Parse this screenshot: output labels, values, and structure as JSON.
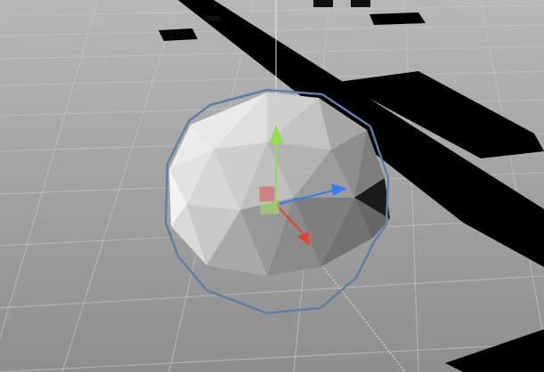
{
  "scene_view": {
    "floor_color": "#a7a7a7",
    "floor_color_near": "#8f8f8f",
    "grid_line_color": "#bdbdbd",
    "shadow_color": "#000000",
    "selection_outline_color": "#5f7fa8"
  },
  "selected_object": {
    "kind": "icosphere",
    "face_light": "#e3e3e3",
    "face_mid": "#b6b6b6",
    "face_dark": "#7a7a7a"
  },
  "transform_gizmo": {
    "y_axis_color": "#8ee04a",
    "x_axis_color": "#3a7cf0",
    "z_axis_color": "#e8402a",
    "plane_xy_color": "#d9534f",
    "plane_xz_color": "#a6e06a",
    "y_axis_icon": "green-cone-arrow",
    "x_axis_icon": "blue-cone-arrow",
    "z_axis_icon": "red-cone-arrow"
  }
}
